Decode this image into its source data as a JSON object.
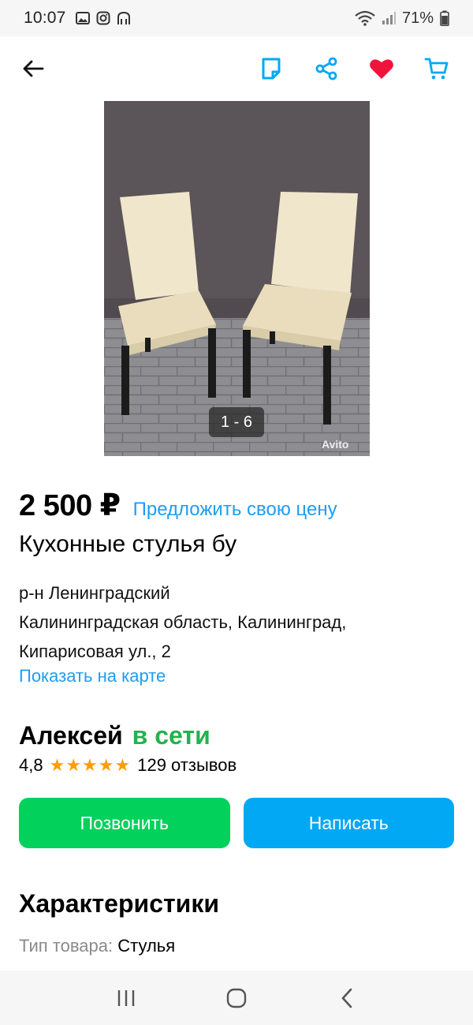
{
  "status_bar": {
    "time": "10:07",
    "battery": "71%"
  },
  "app_bar": {
    "icons": [
      "back-arrow-icon",
      "note-icon",
      "share-icon",
      "favorite-heart-icon",
      "cart-icon"
    ]
  },
  "photo": {
    "counter": "1 - 6",
    "watermark": "Avito"
  },
  "listing": {
    "price": "2 500 ₽",
    "offer_price_link": "Предложить свою цену",
    "title": "Кухонные стулья бу",
    "address_line1": "р-н Ленинградский",
    "address_line2": "Калининградская область, Калининград,",
    "address_line3": "Кипарисовая ул., 2",
    "show_on_map": "Показать на карте"
  },
  "seller": {
    "name": "Алексей",
    "status": "в сети",
    "rating": "4,8",
    "stars": "★★★★★",
    "reviews": "129 отзывов"
  },
  "actions": {
    "call_label": "Позвонить",
    "write_label": "Написать"
  },
  "characteristics": {
    "title": "Характеристики",
    "item_type_label": "Тип товара:",
    "item_type_value": "Стулья"
  },
  "colors": {
    "link": "#1e9df2",
    "online": "#24b24e",
    "call_button": "#02d15c",
    "write_button": "#02a8f4",
    "heart": "#f0143c",
    "stars": "#ff9d00"
  }
}
